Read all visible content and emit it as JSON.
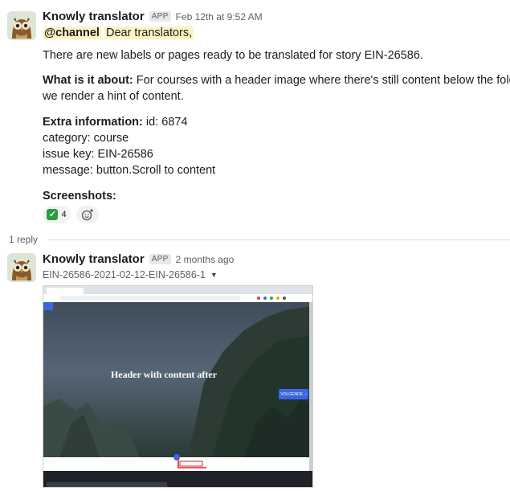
{
  "message": {
    "author": "Knowly translator",
    "badge": "APP",
    "timestamp": "Feb 12th at 9:52 AM",
    "mention": "@channel",
    "greeting": "Dear translators,",
    "intro": "There are new labels or pages ready to be translated for story EIN-26586.",
    "about_label": "What is it about:",
    "about_text_1": "For courses with a header image where there's still content below the fold",
    "about_text_2": "we render a hint of content.",
    "extra_label": "Extra information:",
    "extra_id": "id: 6874",
    "category": "category: course",
    "issue_key": "issue key: EIN-26586",
    "msg": "message: button.Scroll to content",
    "screenshots_label": "Screenshots:"
  },
  "reactions": [
    {
      "icon": "white-check-mark",
      "count": "4"
    },
    {
      "icon": "add-reaction-icon"
    }
  ],
  "thread": {
    "reply_count": "1 reply"
  },
  "reply": {
    "author": "Knowly translator",
    "badge": "APP",
    "timestamp": "2 months ago",
    "file_name": "EIN-26586-2021-02-12-EIN-26586-1",
    "image": {
      "heading": "Header with content after",
      "button_label": "VOLGENDE"
    }
  },
  "colors": {
    "mention_bg": "#fff3c4",
    "accent_blue": "#3a66e0",
    "annotation_red": "#e0262b"
  }
}
